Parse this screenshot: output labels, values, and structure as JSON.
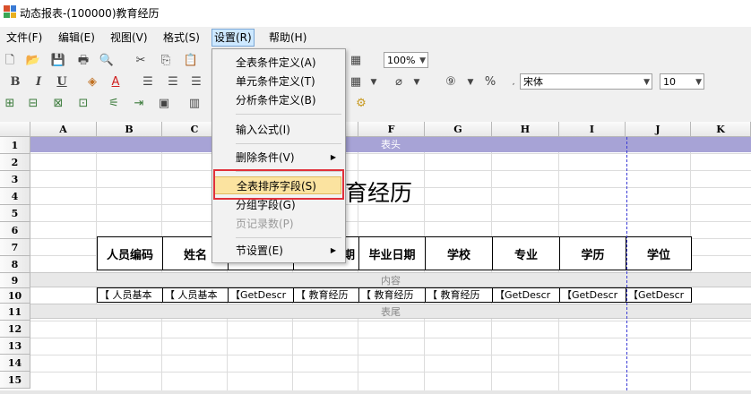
{
  "window": {
    "title": "动态报表-(100000)教育经历"
  },
  "menubar": [
    {
      "label": "文件(F)"
    },
    {
      "label": "编辑(E)"
    },
    {
      "label": "视图(V)"
    },
    {
      "label": "格式(S)"
    },
    {
      "label": "设置(R)"
    },
    {
      "label": "帮助(H)"
    }
  ],
  "toolbar": {
    "zoom": "100%",
    "font_name": "宋体",
    "font_size": "10"
  },
  "settings_menu": {
    "items": [
      {
        "label": "全表条件定义(A)",
        "enabled": true
      },
      {
        "label": "单元条件定义(T)",
        "enabled": true
      },
      {
        "label": "分析条件定义(B)",
        "enabled": true
      },
      {
        "label": "输入公式(I)",
        "enabled": true
      },
      {
        "label": "删除条件(V)",
        "enabled": true,
        "submenu": true
      },
      {
        "label": "全表排序字段(S)",
        "enabled": true,
        "highlighted": true
      },
      {
        "label": "分组字段(G)",
        "enabled": true
      },
      {
        "label": "页记录数(P)",
        "enabled": false
      },
      {
        "label": "节设置(E)",
        "enabled": true,
        "submenu": true
      }
    ]
  },
  "sheet": {
    "columns": [
      "A",
      "B",
      "C",
      "D",
      "E",
      "F",
      "G",
      "H",
      "I",
      "J",
      "K"
    ],
    "rows": [
      "1",
      "2",
      "3",
      "4",
      "5",
      "6",
      "7",
      "8",
      "9",
      "10",
      "11",
      "12",
      "13",
      "14",
      "15"
    ],
    "band_header": "表头",
    "band_content": "内容",
    "band_footer": "表尾",
    "report_title": "教育经历",
    "header_cells": [
      "人员编码",
      "姓名",
      "",
      "期",
      "毕业日期",
      "学校",
      "专业",
      "学历",
      "学位"
    ],
    "data_cells": [
      "【 人员基本",
      "【 人员基本",
      "【GetDescr",
      "【 教育经历",
      "【 教育经历",
      "【 教育经历",
      "【GetDescr",
      "【GetDescr",
      "【GetDescr"
    ]
  },
  "colors": {
    "band_header_bg": "#a7a3d6",
    "highlight": "#fbe3a0",
    "red_outline": "#e0303a"
  }
}
